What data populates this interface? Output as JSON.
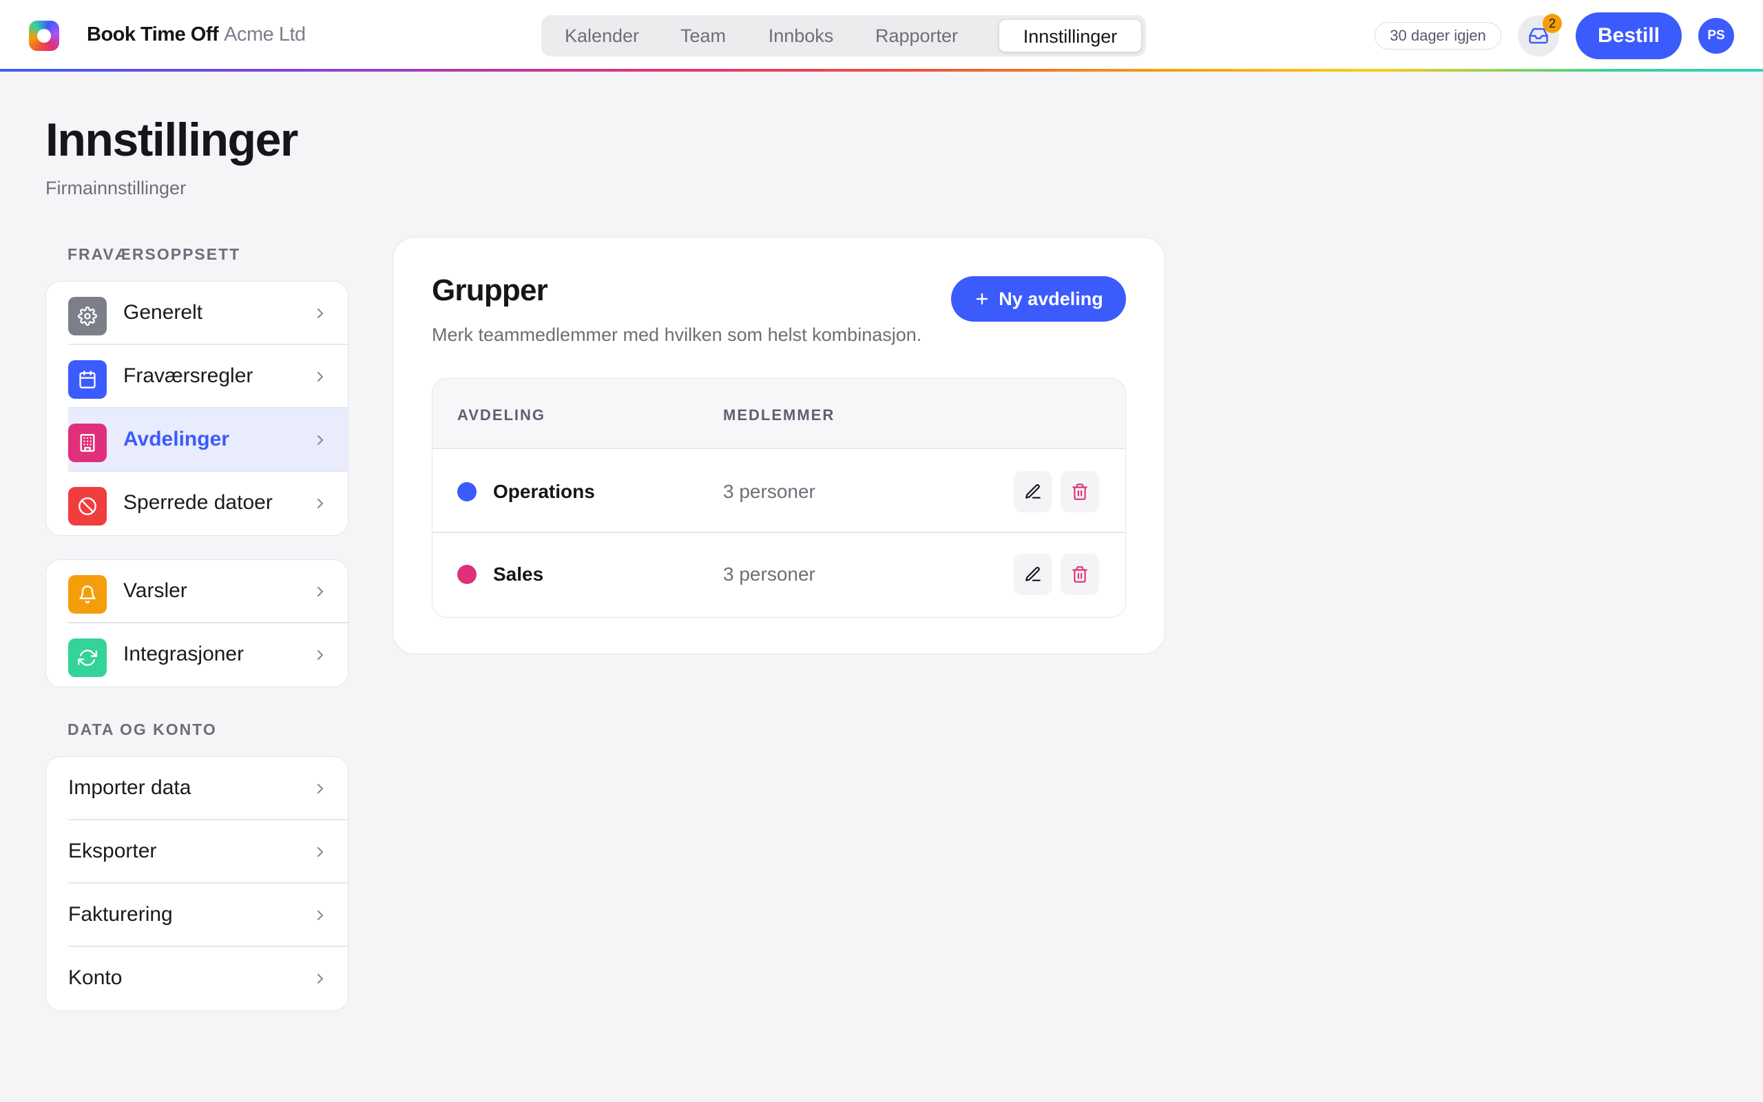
{
  "app": {
    "name": "Book Time Off",
    "org": "Acme Ltd"
  },
  "nav": {
    "tabs": [
      {
        "label": "Kalender"
      },
      {
        "label": "Team"
      },
      {
        "label": "Innboks"
      },
      {
        "label": "Rapporter"
      },
      {
        "label": "Innstillinger",
        "active": true
      }
    ]
  },
  "header": {
    "trial_text": "30 dager igjen",
    "inbox_count": "2",
    "order_label": "Bestill",
    "avatar_initials": "PS"
  },
  "page": {
    "title": "Innstillinger",
    "subtitle": "Firmainnstillinger"
  },
  "sidebar": {
    "section1_label": "FRAVÆRSOPPSETT",
    "group1": [
      {
        "label": "Generelt",
        "icon": "gear-icon",
        "color": "#7c7f88"
      },
      {
        "label": "Fraværsregler",
        "icon": "calendar-icon",
        "color": "#3b5bfd"
      },
      {
        "label": "Avdelinger",
        "icon": "building-icon",
        "color": "#e0307a",
        "active": true
      },
      {
        "label": "Sperrede datoer",
        "icon": "ban-icon",
        "color": "#f03e3e"
      }
    ],
    "group2": [
      {
        "label": "Varsler",
        "icon": "bell-icon",
        "color": "#f59e0b"
      },
      {
        "label": "Integrasjoner",
        "icon": "sync-icon",
        "color": "#34d399"
      }
    ],
    "section2_label": "DATA OG KONTO",
    "group3": [
      {
        "label": "Importer data"
      },
      {
        "label": "Eksporter"
      },
      {
        "label": "Fakturering"
      },
      {
        "label": "Konto"
      }
    ]
  },
  "main": {
    "title": "Grupper",
    "subtitle": "Merk teammedlemmer med hvilken som helst kombinasjon.",
    "new_button_label": "Ny avdeling",
    "table": {
      "columns": [
        "AVDELING",
        "MEDLEMMER"
      ],
      "rows": [
        {
          "name": "Operations",
          "members": "3 personer",
          "color": "#3b5bfd"
        },
        {
          "name": "Sales",
          "members": "3 personer",
          "color": "#e0307a"
        }
      ]
    }
  },
  "colors": {
    "accent": "#3b5bfd",
    "badge": "#f59e0b",
    "danger": "#e0307a"
  }
}
